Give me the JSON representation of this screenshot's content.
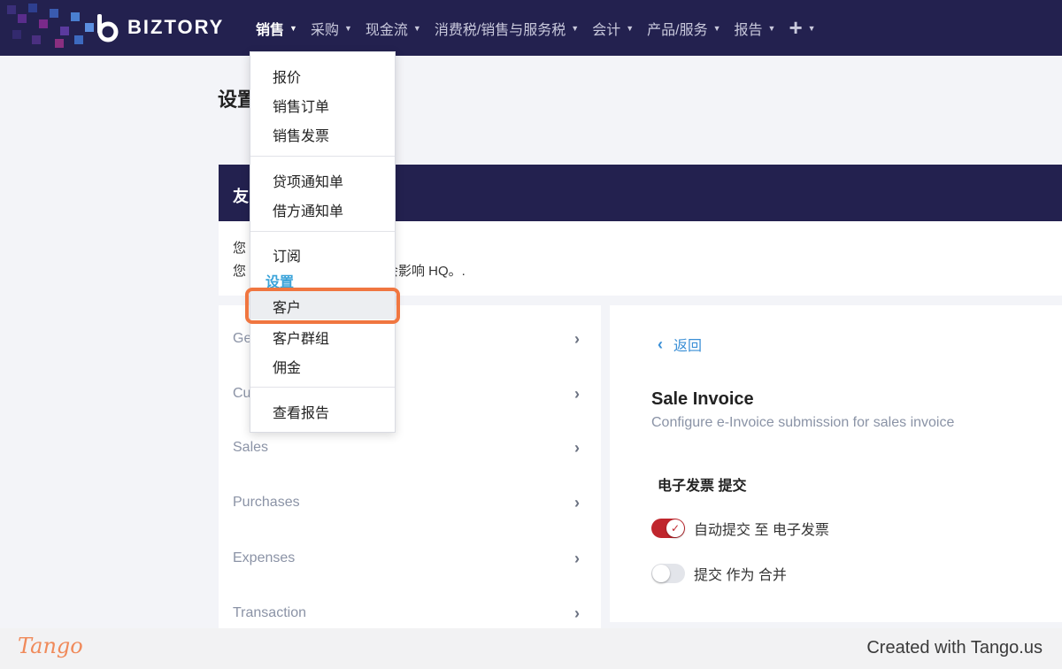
{
  "app": {
    "brand": "BIZTORY",
    "colors": {
      "nav_bg": "#23214f",
      "accent_blue": "#3a8fd6",
      "toggle_on": "#c0262d",
      "highlight": "#f07640"
    }
  },
  "nav": {
    "items": [
      {
        "label": "销售",
        "active": true
      },
      {
        "label": "采购"
      },
      {
        "label": "现金流"
      },
      {
        "label": "消费税/销售与服务税"
      },
      {
        "label": "会计"
      },
      {
        "label": "产品/服务"
      },
      {
        "label": "报告"
      }
    ],
    "plus": "+"
  },
  "dropdown": {
    "group1": [
      "报价",
      "销售订单",
      "销售发票"
    ],
    "group2": [
      "贷项通知单",
      "借方通知单"
    ],
    "group3_item": "订阅",
    "section_header": "设置",
    "group3b": [
      "客户",
      "客户群组",
      "佣金"
    ],
    "group4": [
      "查看报告"
    ],
    "highlighted": "客户"
  },
  "page": {
    "title": "设置",
    "banner_title": "友",
    "notice_line1": "您",
    "notice_line2": "您",
    "notice_tail": "只会影响 HQ。."
  },
  "left_menu": {
    "items": [
      "Ge",
      "Cu",
      "Sales",
      "Purchases",
      "Expenses",
      "Transaction"
    ]
  },
  "right_panel": {
    "back_label": "返回",
    "section_title": "Sale Invoice",
    "section_subtitle": "Configure e-Invoice submission for sales invoice",
    "group_label": "电子发票 提交",
    "toggles": [
      {
        "label": "自动提交 至 电子发票",
        "on": true
      },
      {
        "label": "提交 作为 合并",
        "on": false
      }
    ]
  },
  "footer": {
    "logo": "Tango",
    "credit": "Created with Tango.us"
  }
}
